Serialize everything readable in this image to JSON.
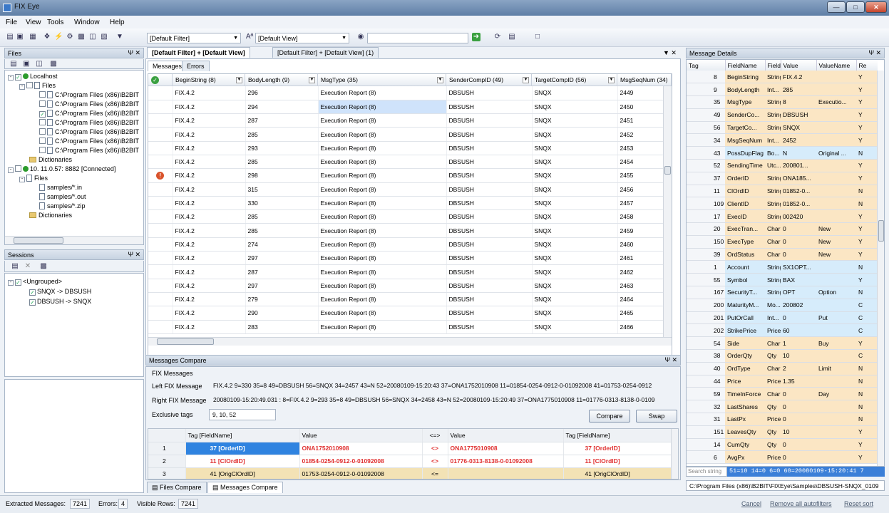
{
  "window": {
    "title": "FIX Eye"
  },
  "menu": [
    "File",
    "View",
    "Tools",
    "Window",
    "Help"
  ],
  "toolbar": {
    "filter": "[Default Filter]",
    "view": "[Default View]"
  },
  "files_panel": {
    "title": "Files",
    "localhost": "Localhost",
    "files": "Files",
    "paths": [
      "C:\\Program Files (x86)\\B2BIT",
      "C:\\Program Files (x86)\\B2BIT",
      "C:\\Program Files (x86)\\B2BIT",
      "C:\\Program Files (x86)\\B2BIT",
      "C:\\Program Files (x86)\\B2BIT",
      "C:\\Program Files (x86)\\B2BIT",
      "C:\\Program Files (x86)\\B2BIT"
    ],
    "dictionaries": "Dictionaries",
    "remote": "10. 11.0.57: 8882 [Connected]",
    "remote_files": "Files",
    "samples": [
      "samples/*.in",
      "samples/*.out",
      "samples/*.zip"
    ],
    "remote_dictionaries": "Dictionaries"
  },
  "sessions_panel": {
    "title": "Sessions",
    "group": "<Ungrouped>",
    "items": [
      "SNQX -> DBSUSH",
      "DBSUSH -> SNQX"
    ]
  },
  "doc_tabs": [
    "[Default Filter] + [Default View]",
    "[Default Filter] + [Default View] (1)"
  ],
  "inner_tabs": [
    "Messages",
    "Errors"
  ],
  "messages": {
    "columns": [
      "BeginString (8)",
      "BodyLength (9)",
      "MsgType (35)",
      "SenderCompID (49)",
      "TargetCompID (56)",
      "MsgSeqNum (34)"
    ],
    "rows": [
      [
        "FIX.4.2",
        "296",
        "Execution Report  (8)",
        "DBSUSH",
        "SNQX",
        "2449"
      ],
      [
        "FIX.4.2",
        "294",
        "Execution Report  (8)",
        "DBSUSH",
        "SNQX",
        "2450"
      ],
      [
        "FIX.4.2",
        "287",
        "Execution Report  (8)",
        "DBSUSH",
        "SNQX",
        "2451"
      ],
      [
        "FIX.4.2",
        "285",
        "Execution Report  (8)",
        "DBSUSH",
        "SNQX",
        "2452"
      ],
      [
        "FIX.4.2",
        "293",
        "Execution Report  (8)",
        "DBSUSH",
        "SNQX",
        "2453"
      ],
      [
        "FIX.4.2",
        "285",
        "Execution Report  (8)",
        "DBSUSH",
        "SNQX",
        "2454"
      ],
      [
        "FIX.4.2",
        "298",
        "Execution Report  (8)",
        "DBSUSH",
        "SNQX",
        "2455"
      ],
      [
        "FIX.4.2",
        "315",
        "Execution Report  (8)",
        "DBSUSH",
        "SNQX",
        "2456"
      ],
      [
        "FIX.4.2",
        "330",
        "Execution Report  (8)",
        "DBSUSH",
        "SNQX",
        "2457"
      ],
      [
        "FIX.4.2",
        "285",
        "Execution Report  (8)",
        "DBSUSH",
        "SNQX",
        "2458"
      ],
      [
        "FIX.4.2",
        "285",
        "Execution Report  (8)",
        "DBSUSH",
        "SNQX",
        "2459"
      ],
      [
        "FIX.4.2",
        "274",
        "Execution Report  (8)",
        "DBSUSH",
        "SNQX",
        "2460"
      ],
      [
        "FIX.4.2",
        "297",
        "Execution Report  (8)",
        "DBSUSH",
        "SNQX",
        "2461"
      ],
      [
        "FIX.4.2",
        "287",
        "Execution Report  (8)",
        "DBSUSH",
        "SNQX",
        "2462"
      ],
      [
        "FIX.4.2",
        "297",
        "Execution Report  (8)",
        "DBSUSH",
        "SNQX",
        "2463"
      ],
      [
        "FIX.4.2",
        "279",
        "Execution Report  (8)",
        "DBSUSH",
        "SNQX",
        "2464"
      ],
      [
        "FIX.4.2",
        "290",
        "Execution Report  (8)",
        "DBSUSH",
        "SNQX",
        "2465"
      ],
      [
        "FIX.4.2",
        "283",
        "Execution Report  (8)",
        "DBSUSH",
        "SNQX",
        "2466"
      ]
    ],
    "selected_row": 1,
    "error_row": 6
  },
  "compare": {
    "title": "Messages Compare",
    "section": "FIX Messages",
    "left_label": "Left FIX Message",
    "left_value": "FIX.4.2 9=330 35=8 49=DBSUSH 56=SNQX 34=2457 43=N 52=20080109-15:20:43 37=ONA1752010908 11=01854-0254-0912-0-01092008 41=01753-0254-0912",
    "right_label": "Right FIX Message",
    "right_value": "20080109-15:20:49.031 : 8=FIX.4.2 9=293 35=8 49=DBSUSH 56=SNQX 34=2458 43=N 52=20080109-15:20:49 37=ONA1775010908 11=01776-0313-8138-0-0109",
    "excl_label": "Exclusive tags",
    "excl_value": "9, 10, 52",
    "compare_btn": "Compare",
    "swap_btn": "Swap",
    "headers": [
      "Tag [FieldName]",
      "Value",
      "<=>",
      "Value",
      "Tag [FieldName]"
    ],
    "rows": [
      {
        "n": "1",
        "ltag": "37 [OrderID]",
        "lval": "ONA1752010908",
        "op": "<>",
        "rval": "ONA1775010908",
        "rtag": "37 [OrderID]"
      },
      {
        "n": "2",
        "ltag": "11 [ClOrdID]",
        "lval": "01854-0254-0912-0-01092008",
        "op": "<>",
        "rval": "01776-0313-8138-0-01092008",
        "rtag": "11 [ClOrdID]"
      },
      {
        "n": "3",
        "ltag": "41 [OrigClOrdID]",
        "lval": "01753-0254-0912-0-01092008",
        "op": "<=",
        "rval": "",
        "rtag": "41 [OrigClOrdID]"
      }
    ]
  },
  "bottom_tabs": [
    "Files Compare",
    "Messages Compare"
  ],
  "details": {
    "title": "Message Details",
    "headers": [
      "Tag",
      "FieldName",
      "FieldT",
      "Value",
      "ValueName",
      "Re"
    ],
    "rows": [
      [
        "8",
        "BeginString",
        "String",
        "FIX.4.2",
        "",
        "Y"
      ],
      [
        "9",
        "BodyLength",
        "Int...",
        "285",
        "",
        "Y"
      ],
      [
        "35",
        "MsgType",
        "String",
        "8",
        "Executio...",
        "Y"
      ],
      [
        "49",
        "SenderCo...",
        "String",
        "DBSUSH",
        "",
        "Y"
      ],
      [
        "56",
        "TargetCo...",
        "String",
        "SNQX",
        "",
        "Y"
      ],
      [
        "34",
        "MsgSeqNum",
        "Int...",
        "2452",
        "",
        "Y"
      ],
      [
        "43",
        "PossDupFlag",
        "Bo...",
        "N",
        "Original ...",
        "N"
      ],
      [
        "52",
        "SendingTime",
        "Utc...",
        "200801...",
        "",
        "Y"
      ],
      [
        "37",
        "OrderID",
        "String",
        "ONA185...",
        "",
        "Y"
      ],
      [
        "11",
        "ClOrdID",
        "String",
        "01852-0...",
        "",
        "N"
      ],
      [
        "109",
        "ClientID",
        "String",
        "01852-0...",
        "",
        "N"
      ],
      [
        "17",
        "ExecID",
        "String",
        "002420",
        "",
        "Y"
      ],
      [
        "20",
        "ExecTran...",
        "Char",
        "0",
        "New",
        "Y"
      ],
      [
        "150",
        "ExecType",
        "Char",
        "0",
        "New",
        "Y"
      ],
      [
        "39",
        "OrdStatus",
        "Char",
        "0",
        "New",
        "Y"
      ],
      [
        "1",
        "Account",
        "String",
        "SX1OPT...",
        "",
        "N"
      ],
      [
        "55",
        "Symbol",
        "String",
        "BAX",
        "",
        "Y"
      ],
      [
        "167",
        "SecurityT...",
        "String",
        "OPT",
        "Option",
        "N"
      ],
      [
        "200",
        "MaturityM...",
        "Mo...",
        "200802",
        "",
        "C"
      ],
      [
        "201",
        "PutOrCall",
        "Int...",
        "0",
        "Put",
        "C"
      ],
      [
        "202",
        "StrikePrice",
        "Price",
        "60",
        "",
        "C"
      ],
      [
        "54",
        "Side",
        "Char",
        "1",
        "Buy",
        "Y"
      ],
      [
        "38",
        "OrderQty",
        "Qty",
        "10",
        "",
        "C"
      ],
      [
        "40",
        "OrdType",
        "Char",
        "2",
        "Limit",
        "N"
      ],
      [
        "44",
        "Price",
        "Price",
        "1.35",
        "",
        "N"
      ],
      [
        "59",
        "TimeInForce",
        "Char",
        "0",
        "Day",
        "N"
      ],
      [
        "32",
        "LastShares",
        "Qty",
        "0",
        "",
        "N"
      ],
      [
        "31",
        "LastPx",
        "Price",
        "0",
        "",
        "N"
      ],
      [
        "151",
        "LeavesQty",
        "Qty",
        "10",
        "",
        "Y"
      ],
      [
        "14",
        "CumQty",
        "Qty",
        "0",
        "",
        "Y"
      ],
      [
        "6",
        "AvgPx",
        "Price",
        "0",
        "",
        "Y"
      ]
    ],
    "search_placeholder": "Search string",
    "raw": "51=10 14=0 6=0 60=20080109-15:20:41 7",
    "path": "C:\\Program Files (x86)\\B2BIT\\FIXEye\\Samples\\DBSUSH-SNQX_0109"
  },
  "status": {
    "extracted_label": "Extracted Messages:",
    "extracted": "7241",
    "errors_label": "Errors:",
    "errors": "4",
    "visible_label": "Visible Rows:",
    "visible": "7241",
    "cancel": "Cancel",
    "remove": "Remove all autofilters",
    "reset": "Reset sort"
  }
}
